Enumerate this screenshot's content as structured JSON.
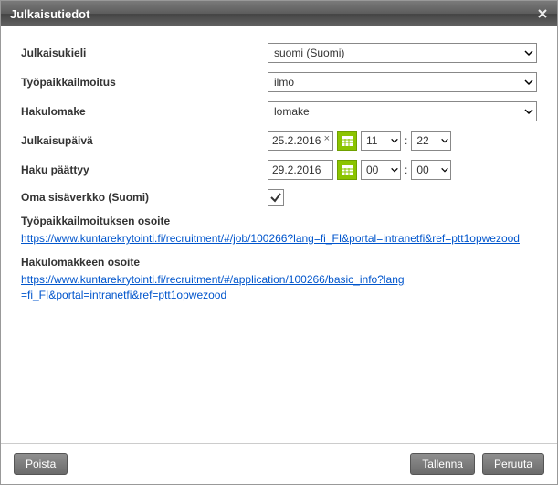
{
  "dialog": {
    "title": "Julkaisutiedot"
  },
  "fields": {
    "language": {
      "label": "Julkaisukieli",
      "value": "suomi (Suomi)"
    },
    "jobAd": {
      "label": "Työpaikkailmoitus",
      "value": "ilmo"
    },
    "form": {
      "label": "Hakulomake",
      "value": "lomake"
    },
    "publishDate": {
      "label": "Julkaisupäivä",
      "date": "25.2.2016",
      "hour": "11",
      "minute": "22"
    },
    "endDate": {
      "label": "Haku päättyy",
      "date": "29.2.2016",
      "hour": "00",
      "minute": "00"
    },
    "intranet": {
      "label": "Oma sisäverkko (Suomi)",
      "checked": true
    }
  },
  "sections": {
    "jobAdUrl": {
      "label": "Työpaikkailmoituksen osoite",
      "url": "https://www.kuntarekrytointi.fi/recruitment/#/job/100266?lang=fi_FI&portal=intranetfi&ref=ptt1opwezood"
    },
    "formUrl": {
      "label": "Hakulomakkeen osoite",
      "url": "https://www.kuntarekrytointi.fi/recruitment/#/application/100266/basic_info?lang=fi_FI&portal=intranetfi&ref=ptt1opwezood"
    }
  },
  "buttons": {
    "delete": "Poista",
    "save": "Tallenna",
    "cancel": "Peruuta"
  },
  "timeSep": ":"
}
